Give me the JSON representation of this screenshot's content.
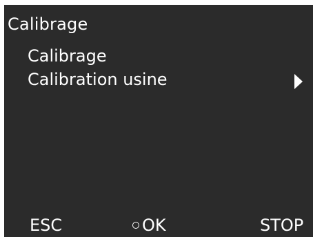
{
  "screen": {
    "title": "Calibrage",
    "menu": [
      {
        "label": "Calibrage"
      },
      {
        "label": "Calibration usine",
        "has_submenu": true,
        "icon": "chevron-right-icon"
      }
    ]
  },
  "softkeys": {
    "esc": "ESC",
    "ok": "OK",
    "ok_icon": "circle-icon",
    "stop": "STOP"
  },
  "colors": {
    "screen_background": "#2b2b2b",
    "text": "#ffffff",
    "frame": "#ffffff"
  }
}
